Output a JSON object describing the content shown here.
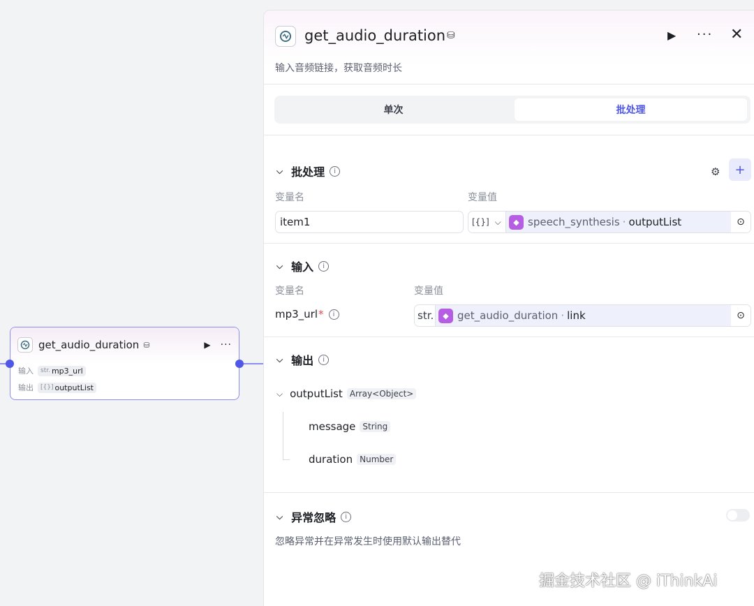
{
  "node": {
    "title": "get_audio_duration",
    "input_label": "输入",
    "input_type": "str.",
    "input_var": "mp3_url",
    "output_label": "输出",
    "output_type": "[{}]",
    "output_var": "outputList"
  },
  "panel": {
    "title": "get_audio_duration",
    "description": "输入音频链接，获取音频时长",
    "modes": {
      "single": "单次",
      "batch": "批处理",
      "active": "batch"
    },
    "batch": {
      "title": "批处理",
      "col_name": "变量名",
      "col_value": "变量值",
      "item_name": "item1",
      "value_type": "[{}]",
      "source_node": "speech_synthesis",
      "source_key": "outputList"
    },
    "input": {
      "title": "输入",
      "col_name": "变量名",
      "col_value": "变量值",
      "param_name": "mp3_url",
      "required_mark": "*",
      "value_type": "str.",
      "source_node": "get_audio_duration",
      "source_key": "link"
    },
    "output": {
      "title": "输出",
      "root_name": "outputList",
      "root_type": "Array<Object>",
      "children": [
        {
          "name": "message",
          "type": "String"
        },
        {
          "name": "duration",
          "type": "Number"
        }
      ]
    },
    "ignore": {
      "title": "异常忽略",
      "description": "忽略异常并在异常发生时使用默认输出替代",
      "enabled": false
    }
  },
  "watermark": "掘金技术社区 @ iThinkAi",
  "colors": {
    "accent": "#4e57e6",
    "node_border": "#8b8ef0",
    "cube": "#b65ee3"
  }
}
